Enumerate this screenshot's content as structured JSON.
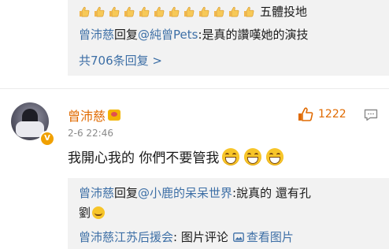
{
  "thread_top": {
    "thumbs_count": 12,
    "thumbs_suffix": "五體投地",
    "reply": {
      "author": "曾沛慈",
      "verb": "回复",
      "mention": "@純曾Pets",
      "text": ":是真的讚嘆她的演技"
    },
    "total_replies": "共706条回复 >"
  },
  "comment": {
    "author": "曾沛慈",
    "time": "2-6 22:46",
    "likes": "1222",
    "body": "我開心我的 你們不要管我",
    "emoji_count": 3,
    "avatar_badge": "V"
  },
  "replies": [
    {
      "author": "曾沛慈",
      "verb": "回复",
      "mention": "@小鹿的呆呆世界",
      "text": ":說真的  還有孔",
      "text2": "劉"
    },
    {
      "author": "曾沛慈江苏后援会",
      "text": ": 图片评论",
      "link": "查看图片"
    }
  ],
  "colors": {
    "name": "#3d6fa6",
    "likes": "#e06a00",
    "reply_bg": "#f2f2f2"
  }
}
